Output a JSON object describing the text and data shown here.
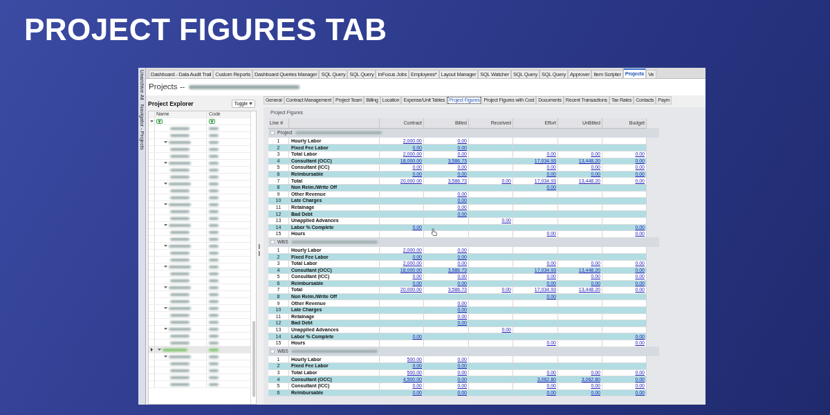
{
  "title": "PROJECT FIGURES TAB",
  "side_strip": [
    "Unarchive All",
    "Navigator - Projects"
  ],
  "top_tabs": [
    {
      "label": "Dashboard - Data Audit Trail",
      "selected": false
    },
    {
      "label": "Custom Reports",
      "selected": false
    },
    {
      "label": "Dashboard Queries Manager",
      "selected": false
    },
    {
      "label": "SQL Query",
      "selected": false
    },
    {
      "label": "SQL Query",
      "selected": false
    },
    {
      "label": "InFocus Jobs",
      "selected": false
    },
    {
      "label": "Employees*",
      "selected": false
    },
    {
      "label": "Layout Manager",
      "selected": false
    },
    {
      "label": "SQL Watcher",
      "selected": false
    },
    {
      "label": "SQL Query",
      "selected": false
    },
    {
      "label": "SQL Query",
      "selected": false
    },
    {
      "label": "Approver",
      "selected": false
    },
    {
      "label": "Item Scripter",
      "selected": false
    },
    {
      "label": "Projects",
      "selected": true
    },
    {
      "label": "Ve",
      "selected": false
    }
  ],
  "page_title": "Projects --",
  "explorer": {
    "title": "Project Explorer",
    "toggle": "Toggle",
    "columns": [
      "Name",
      "Code"
    ]
  },
  "sub_tabs": [
    {
      "label": "General",
      "selected": false
    },
    {
      "label": "Contract Management",
      "selected": false
    },
    {
      "label": "Project Team",
      "selected": false
    },
    {
      "label": "Billing",
      "selected": false
    },
    {
      "label": "Location",
      "selected": false
    },
    {
      "label": "Expense/Unit Tables",
      "selected": false
    },
    {
      "label": "Project Figures",
      "selected": true
    },
    {
      "label": "Project Figures with Cost",
      "selected": false
    },
    {
      "label": "Documents",
      "selected": false
    },
    {
      "label": "Recent Transactions",
      "selected": false
    },
    {
      "label": "Tax Rates",
      "selected": false
    },
    {
      "label": "Contacts",
      "selected": false
    },
    {
      "label": "Paym",
      "selected": false
    }
  ],
  "figures": {
    "title": "Project Figures",
    "line_header": "Line #",
    "columns": [
      "Contract",
      "Billed",
      "Received",
      "Effort",
      "UnBilled",
      "Budget"
    ],
    "groups": [
      {
        "label": "Project",
        "checked": false,
        "rows": [
          {
            "line": "1",
            "label": "Hourly Labor",
            "contract": "2,000.00",
            "billed": "0.00"
          },
          {
            "line": "2",
            "label": "Fixed Fee Labor",
            "contract": "0.00",
            "billed": "0.00"
          },
          {
            "line": "3",
            "label": "Total Labor",
            "contract": "2,000.00",
            "billed": "0.00",
            "effort": "0.00",
            "unbilled": "0.00",
            "budget": "0.00"
          },
          {
            "line": "4",
            "label": "Consultant (OCC)",
            "contract": "18,000.00",
            "billed": "3,586.73",
            "effort": "17,034.93",
            "unbilled": "13,448.20",
            "budget": "0.00"
          },
          {
            "line": "5",
            "label": "Consultant (ICC)",
            "contract": "0.00",
            "billed": "0.00",
            "effort": "0.00",
            "unbilled": "0.00",
            "budget": "0.00"
          },
          {
            "line": "6",
            "label": "Reimbursable",
            "contract": "0.00",
            "billed": "0.00",
            "effort": "0.00",
            "unbilled": "0.00",
            "budget": "0.00"
          },
          {
            "line": "7",
            "label": "Total",
            "contract": "20,000.00",
            "billed": "3,586.73",
            "received": "0.00",
            "effort": "17,034.93",
            "unbilled": "13,448.20",
            "budget": "0.00"
          },
          {
            "line": "8",
            "label": "Non Reim./Write Off",
            "effort": "0.00"
          },
          {
            "line": "9",
            "label": "Other Revenue",
            "billed": "0.00"
          },
          {
            "line": "10",
            "label": "Late Charges",
            "billed": "0.00"
          },
          {
            "line": "11",
            "label": "Retainage",
            "billed": "0.00"
          },
          {
            "line": "12",
            "label": "Bad Debt",
            "billed": "0.00"
          },
          {
            "line": "13",
            "label": "Unapplied Advances",
            "received": "0.00"
          },
          {
            "line": "14",
            "label": "Labor % Complete",
            "contract": "0.00",
            "budget": "0.00"
          },
          {
            "line": "15",
            "label": "Hours",
            "effort": "0.00",
            "budget": "0.00"
          }
        ]
      },
      {
        "label": "WBS",
        "checked": false,
        "rows": [
          {
            "line": "1",
            "label": "Hourly Labor",
            "contract": "2,000.00",
            "billed": "0.00"
          },
          {
            "line": "2",
            "label": "Fixed Fee Labor",
            "contract": "0.00",
            "billed": "0.00"
          },
          {
            "line": "3",
            "label": "Total Labor",
            "contract": "2,000.00",
            "billed": "0.00",
            "effort": "0.00",
            "unbilled": "0.00",
            "budget": "0.00"
          },
          {
            "line": "4",
            "label": "Consultant (OCC)",
            "contract": "18,000.00",
            "billed": "3,586.73",
            "effort": "17,034.93",
            "unbilled": "13,448.20",
            "budget": "0.00"
          },
          {
            "line": "5",
            "label": "Consultant (ICC)",
            "contract": "0.00",
            "billed": "0.00",
            "effort": "0.00",
            "unbilled": "0.00",
            "budget": "0.00"
          },
          {
            "line": "6",
            "label": "Reimbursable",
            "contract": "0.00",
            "billed": "0.00",
            "effort": "0.00",
            "unbilled": "0.00",
            "budget": "0.00"
          },
          {
            "line": "7",
            "label": "Total",
            "contract": "20,000.00",
            "billed": "3,586.73",
            "received": "0.00",
            "effort": "17,034.93",
            "unbilled": "13,448.20",
            "budget": "0.00"
          },
          {
            "line": "8",
            "label": "Non Reim./Write Off",
            "effort": "0.00"
          },
          {
            "line": "9",
            "label": "Other Revenue",
            "billed": "0.00"
          },
          {
            "line": "10",
            "label": "Late Charges",
            "billed": "0.00"
          },
          {
            "line": "11",
            "label": "Retainage",
            "billed": "0.00"
          },
          {
            "line": "12",
            "label": "Bad Debt",
            "billed": "0.00"
          },
          {
            "line": "13",
            "label": "Unapplied Advances",
            "received": "0.00"
          },
          {
            "line": "14",
            "label": "Labor % Complete",
            "contract": "0.00",
            "budget": "0.00"
          },
          {
            "line": "15",
            "label": "Hours",
            "effort": "0.00",
            "budget": "0.00"
          }
        ]
      },
      {
        "label": "WBS",
        "checked": false,
        "rows": [
          {
            "line": "1",
            "label": "Hourly Labor",
            "contract": "500.00",
            "billed": "0.00"
          },
          {
            "line": "2",
            "label": "Fixed Fee Labor",
            "contract": "0.00",
            "billed": "0.00"
          },
          {
            "line": "3",
            "label": "Total Labor",
            "contract": "500.00",
            "billed": "0.00",
            "effort": "0.00",
            "unbilled": "0.00",
            "budget": "0.00"
          },
          {
            "line": "4",
            "label": "Consultant (OCC)",
            "contract": "4,500.00",
            "billed": "0.00",
            "effort": "3,062.80",
            "unbilled": "3,062.80",
            "budget": "0.00"
          },
          {
            "line": "5",
            "label": "Consultant (ICC)",
            "contract": "0.00",
            "billed": "0.00",
            "effort": "0.00",
            "unbilled": "0.00",
            "budget": "0.00"
          },
          {
            "line": "6",
            "label": "Reimbursable",
            "contract": "0.00",
            "billed": "0.00",
            "effort": "0.00",
            "unbilled": "0.00",
            "budget": "0.00"
          }
        ]
      }
    ]
  }
}
